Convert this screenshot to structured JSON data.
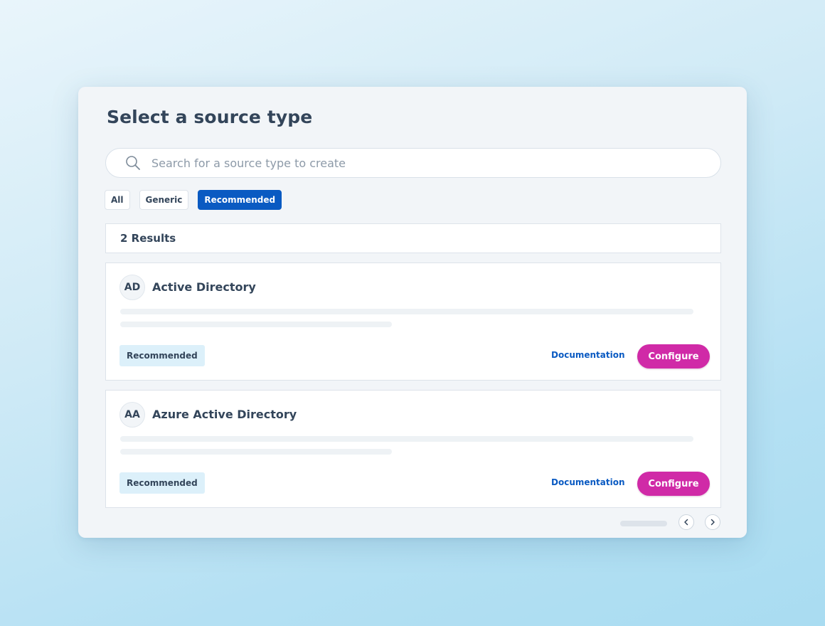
{
  "dialog": {
    "title": "Select a source type"
  },
  "search": {
    "placeholder": "Search for a source type to create",
    "value": "",
    "icon": "search-icon"
  },
  "filters": [
    {
      "label": "All",
      "active": false
    },
    {
      "label": "Generic",
      "active": false
    },
    {
      "label": "Recommended",
      "active": true
    }
  ],
  "results": {
    "count_label": "2 Results"
  },
  "cards": [
    {
      "initials": "AD",
      "name": "Active Directory",
      "badge": "Recommended",
      "doc_label": "Documentation",
      "configure_label": "Configure"
    },
    {
      "initials": "AA",
      "name": "Azure Active Directory",
      "badge": "Recommended",
      "doc_label": "Documentation",
      "configure_label": "Configure"
    }
  ],
  "pagination": {
    "prev_icon": "chevron-left-icon",
    "next_icon": "chevron-right-icon"
  },
  "colors": {
    "accent": "#0a5ac2",
    "configure": "#d02aa7",
    "badge_bg": "#dcf0fa",
    "text": "#33455a"
  }
}
